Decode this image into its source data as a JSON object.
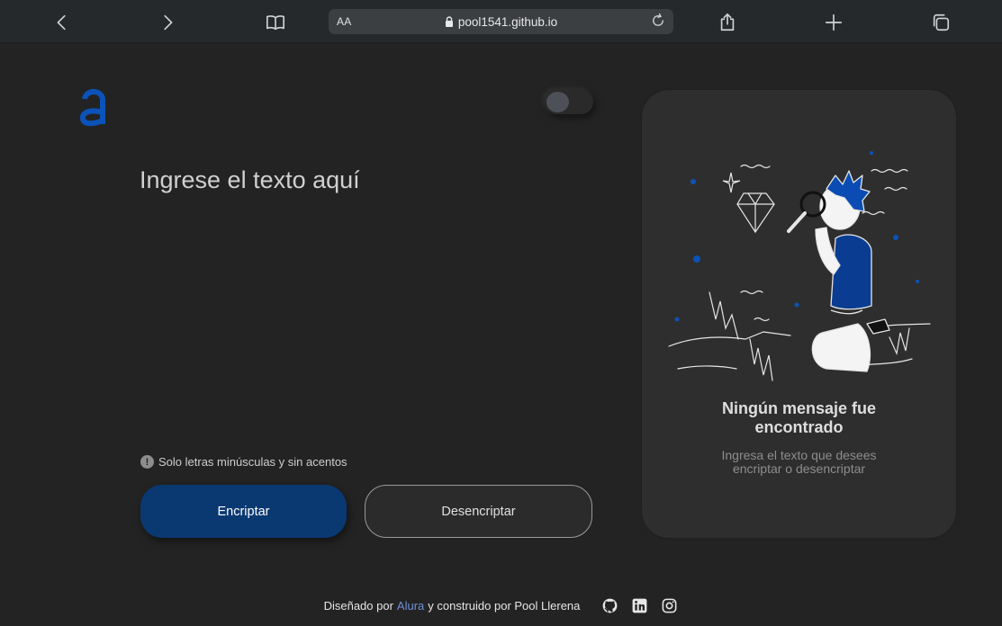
{
  "browser": {
    "text_size_label": "AA",
    "url": "pool1541.github.io",
    "icons": [
      "back-icon",
      "forward-icon",
      "book-icon",
      "lock-icon",
      "reload-icon",
      "share-icon",
      "plus-icon",
      "tabs-icon"
    ]
  },
  "page": {
    "logo": "a",
    "theme_toggle": {
      "state": "off"
    },
    "input": {
      "placeholder": "Ingrese el texto aquí",
      "value": ""
    },
    "hint": {
      "icon": "!",
      "text": "Solo letras minúsculas y sin acentos"
    },
    "buttons": {
      "encrypt": "Encriptar",
      "decrypt": "Desencriptar"
    },
    "result_card": {
      "title": "Ningún mensaje fue encontrado",
      "subtitle": "Ingresa el texto que desees encriptar o desencriptar"
    },
    "footer": {
      "prefix": "Diseñado por",
      "link": "Alura",
      "suffix": "y construido por Pool Llerena",
      "icons": [
        "github-icon",
        "linkedin-icon",
        "instagram-icon"
      ]
    }
  },
  "colors": {
    "accent": "#0a3871",
    "background": "#232323",
    "card": "#2e2e2e",
    "link": "#6e8fd6"
  }
}
